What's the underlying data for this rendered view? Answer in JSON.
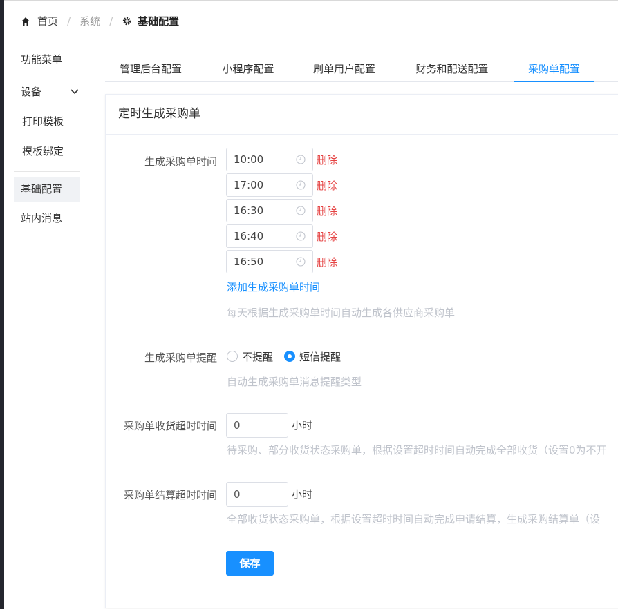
{
  "breadcrumb": {
    "home": "首页",
    "system": "系统",
    "current": "基础配置"
  },
  "sidebar": {
    "items": [
      {
        "label": "功能菜单"
      },
      {
        "label": "设备"
      },
      {
        "label": "打印模板"
      },
      {
        "label": "模板绑定"
      },
      {
        "label": "基础配置"
      },
      {
        "label": "站内消息"
      }
    ]
  },
  "tabs": [
    {
      "label": "管理后台配置"
    },
    {
      "label": "小程序配置"
    },
    {
      "label": "刷单用户配置"
    },
    {
      "label": "财务和配送配置"
    },
    {
      "label": "采购单配置"
    }
  ],
  "card": {
    "title": "定时生成采购单"
  },
  "schedule": {
    "label": "生成采购单时间",
    "times": [
      "10:00",
      "17:00",
      "16:30",
      "16:40",
      "16:50"
    ],
    "delete_label": "删除",
    "add_label": "添加生成采购单时间",
    "hint": "每天根据生成采购单时间自动生成各供应商采购单"
  },
  "reminder": {
    "label": "生成采购单提醒",
    "options": [
      "不提醒",
      "短信提醒"
    ],
    "selected": "短信提醒",
    "hint": "自动生成采购单消息提醒类型"
  },
  "receive_timeout": {
    "label": "采购单收货超时时间",
    "value": "0",
    "unit": "小时",
    "hint": "待采购、部分收货状态采购单，根据设置超时时间自动完成全部收货（设置0为不开"
  },
  "settle_timeout": {
    "label": "采购单结算超时时间",
    "value": "0",
    "unit": "小时",
    "hint": "全部收货状态采购单，根据设置超时时间自动完成申请结算，生成采购结算单（设"
  },
  "save_label": "保存",
  "colors": {
    "accent": "#1890ff",
    "danger": "#e54242",
    "hint": "#c0c4cc"
  }
}
